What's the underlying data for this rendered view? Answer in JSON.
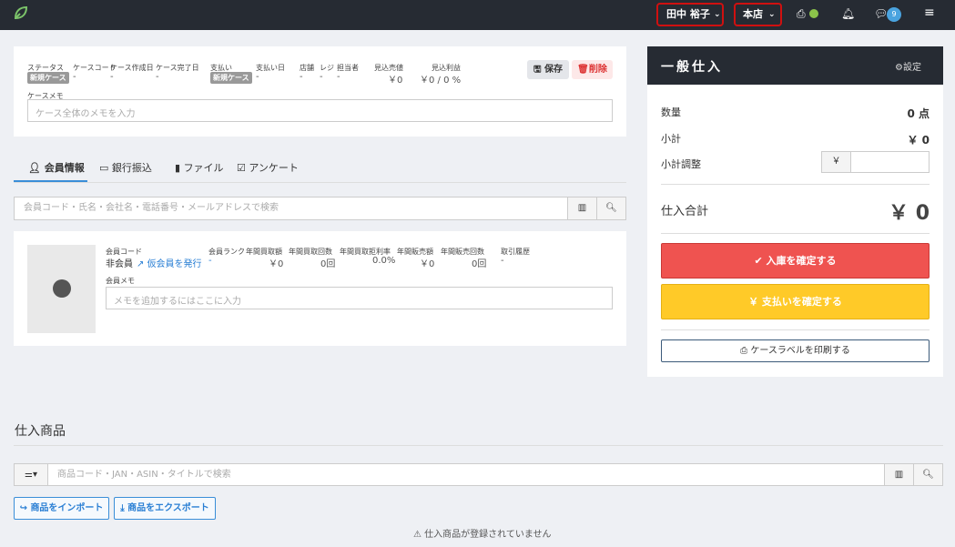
{
  "topbar": {
    "user_name": "田中 裕子",
    "store_name": "本店",
    "notification_count": "9"
  },
  "case": {
    "status_label": "ステータス",
    "status_value": "新規ケース",
    "code_label": "ケースコード",
    "code_value": "-",
    "created_label": "ケース作成日",
    "created_value": "-",
    "completed_label": "ケース完了日",
    "completed_value": "-",
    "payment_label": "支払い",
    "payment_value": "新規ケース",
    "paydate_label": "支払い日",
    "paydate_value": "-",
    "shop_label": "店舗",
    "shop_value": "-",
    "register_label": "レジ",
    "register_value": "-",
    "staff_label": "担当者",
    "staff_value": "-",
    "est_sales_label": "見込売値",
    "est_sales_value": "￥0",
    "est_profit_label": "見込利益",
    "est_profit_value": "￥0 / 0 %",
    "save_label": "保存",
    "delete_label": "削除",
    "memo_label": "ケースメモ",
    "memo_placeholder": "ケース全体のメモを入力"
  },
  "tabs": [
    "会員情報",
    "銀行振込",
    "ファイル",
    "アンケート"
  ],
  "member_search_placeholder": "会員コード・氏名・会社名・電話番号・メールアドレスで検索",
  "member": {
    "code_label": "会員コード",
    "code_value": "非会員",
    "temp_link": "仮会員を発行",
    "rank_label": "会員ランク",
    "rank_value": "-",
    "annual_buy_amount_label": "年間買取額",
    "annual_buy_amount_value": "￥0",
    "annual_buy_count_label": "年間買取回数",
    "annual_buy_count_value": "0回",
    "annual_reject_rate_label": "年間買取拒利率",
    "annual_reject_rate_value": "0.0%",
    "annual_sales_amount_label": "年間販売額",
    "annual_sales_amount_value": "￥0",
    "annual_sales_count_label": "年間販売回数",
    "annual_sales_count_value": "0回",
    "history_label": "取引履歴",
    "history_value": "-",
    "memo_label": "会員メモ",
    "memo_placeholder": "メモを追加するにはここに入力"
  },
  "right_panel": {
    "title": "一般仕入",
    "settings_label": "設定",
    "qty_label": "数量",
    "qty_value": "0 点",
    "subtotal_label": "小計",
    "subtotal_value": "￥ 0",
    "adjust_label": "小計調整",
    "adjust_currency": "￥",
    "total_label": "仕入合計",
    "total_value": "￥ 0",
    "confirm_stock_label": "入庫を確定する",
    "confirm_pay_label": "￥ 支払いを確定する",
    "print_label_label": "ケースラベルを印刷する"
  },
  "products": {
    "heading": "仕入商品",
    "search_placeholder": "商品コード・JAN・ASIN・タイトルで検索",
    "import_label": "商品をインポート",
    "export_label": "商品をエクスポート",
    "empty_message": "仕入商品が登録されていません"
  }
}
